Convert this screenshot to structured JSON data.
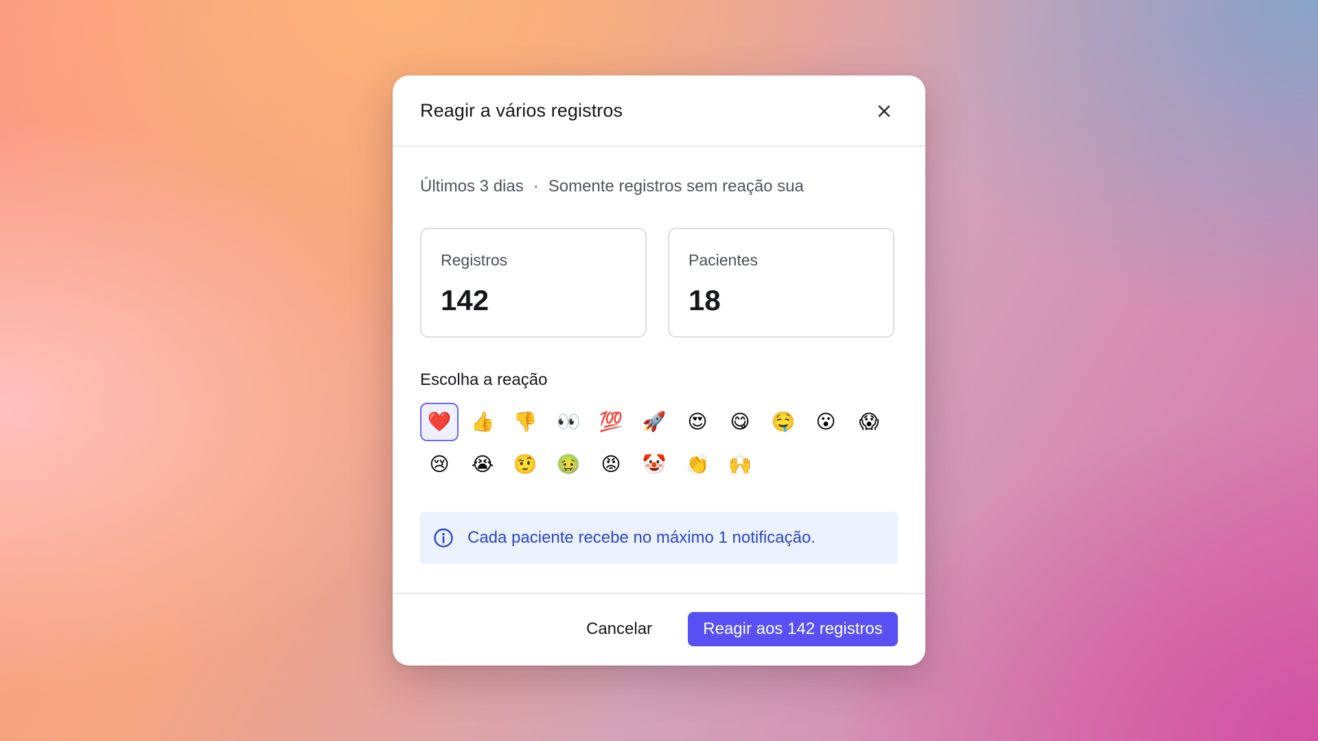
{
  "modal": {
    "title": "Reagir a vários registros",
    "close_icon": "close-icon"
  },
  "filters": {
    "period": "Últimos 3 dias",
    "separator": "·",
    "scope": "Somente registros sem reação sua"
  },
  "stats": {
    "records": {
      "label": "Registros",
      "value": "142"
    },
    "patients": {
      "label": "Pacientes",
      "value": "18"
    }
  },
  "reactions": {
    "heading": "Escolha a reação",
    "selected_index": 0,
    "emojis": [
      "❤️",
      "👍",
      "👎",
      "👀",
      "💯",
      "🚀",
      "😍",
      "😋",
      "🤤",
      "😮",
      "😱",
      "😢",
      "😭",
      "🤨",
      "🤢",
      "😡",
      "🤡",
      "👏",
      "🙌"
    ]
  },
  "info": {
    "icon": "info-icon",
    "text": "Cada paciente recebe no máximo 1 notificação."
  },
  "footer": {
    "cancel_label": "Cancelar",
    "submit_label": "Reagir aos 142 registros"
  },
  "colors": {
    "primary": "#5850f2",
    "info_bg": "#ebf2fd",
    "info_text": "#2a46c8",
    "selected_border": "#6c63ff"
  }
}
